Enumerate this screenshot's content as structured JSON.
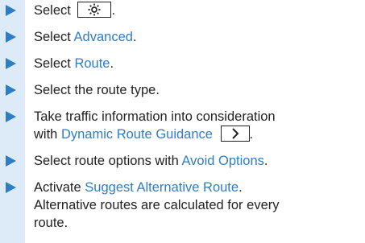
{
  "steps": [
    {
      "prefix": "Select",
      "icon": "gear-icon",
      "suffix": "."
    },
    {
      "prefix": "Select ",
      "link": "Advanced",
      "suffix": "."
    },
    {
      "prefix": "Select ",
      "link": "Route",
      "suffix": "."
    },
    {
      "text": "Select the route type."
    },
    {
      "line1": "Take traffic information into consideration",
      "line2_prefix": "with ",
      "link": "Dynamic Route Guidance",
      "icon": "chevron-right-icon",
      "suffix": "."
    },
    {
      "prefix": "Select route options with ",
      "link": "Avoid Options",
      "suffix": "."
    },
    {
      "prefix": "Activate ",
      "link": "Suggest Alternative Route",
      "suffix": ".",
      "line2": "Alternative routes are calculated for every",
      "line3": "route."
    }
  ],
  "colors": {
    "accent": "#2f7dc4",
    "bar": "#dcebf7",
    "text": "#222222"
  }
}
